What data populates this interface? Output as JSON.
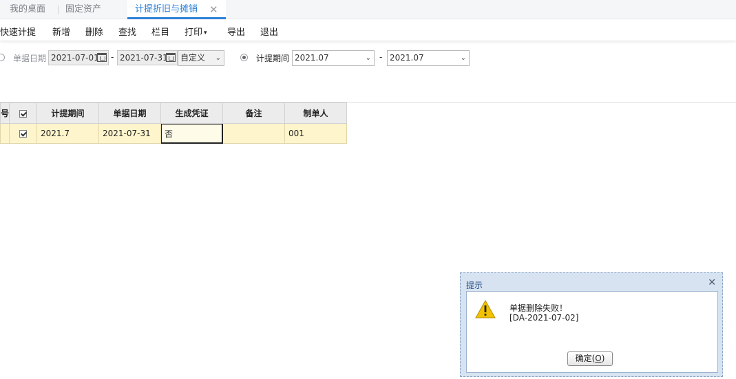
{
  "tabs": [
    {
      "label": "我的桌面"
    },
    {
      "label": "固定资产"
    },
    {
      "label": "计提折旧与摊销",
      "active": true,
      "close": "✕"
    }
  ],
  "toolbar": {
    "quick_accrue": "快速计提",
    "add": "新增",
    "delete": "删除",
    "find": "查找",
    "columns": "栏目",
    "print": "打印",
    "export": "导出",
    "exit": "退出"
  },
  "filter": {
    "bill_date_label": "单据日期",
    "date_from": "2021-07-01",
    "date_to": "2021-07-31",
    "range_dash": "-",
    "date_preset": "自定义",
    "period_label": "计提期间",
    "period_from": "2021.07",
    "period_to": "2021.07",
    "period_dash": "-",
    "selected_mode": "period"
  },
  "grid": {
    "columns": {
      "index": "号",
      "period": "计提期间",
      "bill_date": "单据日期",
      "voucher": "生成凭证",
      "remark": "备注",
      "maker": "制单人"
    },
    "rows": [
      {
        "checked": true,
        "period": "2021.7",
        "bill_date": "2021-07-31",
        "voucher": "否",
        "remark": "",
        "maker": "001"
      }
    ]
  },
  "dialog": {
    "title": "提示",
    "close": "✕",
    "message_line1": "单据删除失败！",
    "message_line2": "[DA-2021-07-02]",
    "ok_prefix": "确定(",
    "ok_key": "O",
    "ok_suffix": ")"
  },
  "colors": {
    "accent": "#2a7fd6",
    "row_highlight": "#fff5cc",
    "dialog_frame": "#d7e3f1",
    "warning": "#f2c200"
  },
  "icons": [
    "calendar-icon",
    "chevron-down-icon",
    "warning-icon",
    "close-icon"
  ]
}
